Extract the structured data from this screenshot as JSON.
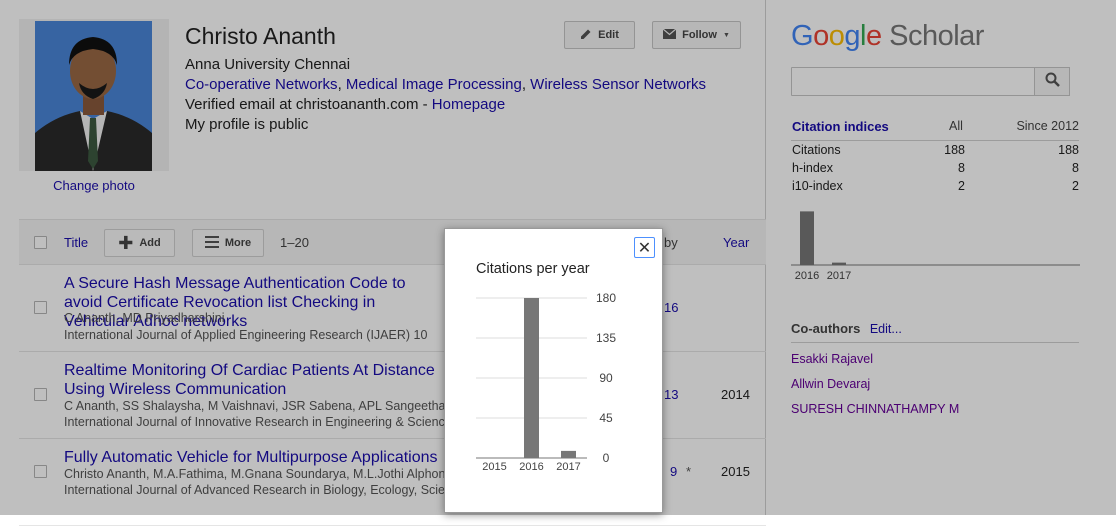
{
  "profile": {
    "name": "Christo Ananth",
    "affiliation": "Anna University Chennai",
    "interests": [
      "Co-operative Networks",
      "Medical Image Processing",
      "Wireless Sensor Networks"
    ],
    "email_text": "Verified email at christoananth.com -",
    "homepage": "Homepage",
    "visibility": "My profile is public",
    "change_photo": "Change photo",
    "edit_label": "Edit",
    "follow_label": "Follow"
  },
  "toolbar": {
    "title_label": "Title",
    "add_label": "Add",
    "more_label": "More",
    "range": "1–20",
    "cited_by_label": "by",
    "year_label": "Year"
  },
  "articles": [
    {
      "title": "A Secure Hash Message Authentication Code to avoid Certificate Revocation list Checking in Vehicular Adhoc networks",
      "authors": "C Ananth, MD Priyadharshini",
      "venue": "International Journal of Applied Engineering Research (IJAER) 10",
      "cited": "16",
      "year": ""
    },
    {
      "title": "Realtime Monitoring Of Cardiac Patients At Distance Using Wireless Communication",
      "authors": "C Ananth, SS Shalaysha, M Vaishnavi, JSR Sabena, APL Sangeetha",
      "venue": "International Journal of Innovative Research in Engineering & Science",
      "cited": "13",
      "year": "2014"
    },
    {
      "title": "Fully Automatic Vehicle for Multipurpose Applications",
      "authors": "Christo Ananth, M.A.Fathima, M.Gnana Soundarya, M.L.Jothi Alphonsa",
      "venue": "International Journal of Advanced Research in Biology, Ecology, Science",
      "cited": "9",
      "star": "*",
      "year": "2015"
    }
  ],
  "sidebar": {
    "logo": {
      "google": "Google",
      "scholar": "Scholar"
    },
    "search_placeholder": "",
    "citation_indices": {
      "header": [
        "Citation indices",
        "All",
        "Since 2012"
      ],
      "rows": [
        [
          "Citations",
          "188",
          "188"
        ],
        [
          "h-index",
          "8",
          "8"
        ],
        [
          "i10-index",
          "2",
          "2"
        ]
      ]
    },
    "mini_chart": {
      "years": [
        "2016",
        "2017"
      ],
      "values": [
        180,
        8
      ]
    },
    "coauthors_label": "Co-authors",
    "coauthors_edit": "Edit...",
    "coauthors": [
      "Esakki Rajavel",
      "Allwin Devaraj",
      "SURESH CHINNATHAMPY M"
    ]
  },
  "modal": {
    "close_symbol": "✕",
    "title": "Citations per year"
  },
  "chart_data": {
    "type": "bar",
    "title": "Citations per year",
    "categories": [
      "2015",
      "2016",
      "2017"
    ],
    "values": [
      0,
      180,
      8
    ],
    "ylim": [
      0,
      180
    ],
    "yticks": [
      0,
      45,
      90,
      135,
      180
    ],
    "grid": true,
    "bar_color": "#777777"
  },
  "colors": {
    "link": "#1a0dab",
    "visited": "#660099",
    "bar": "#777777"
  }
}
